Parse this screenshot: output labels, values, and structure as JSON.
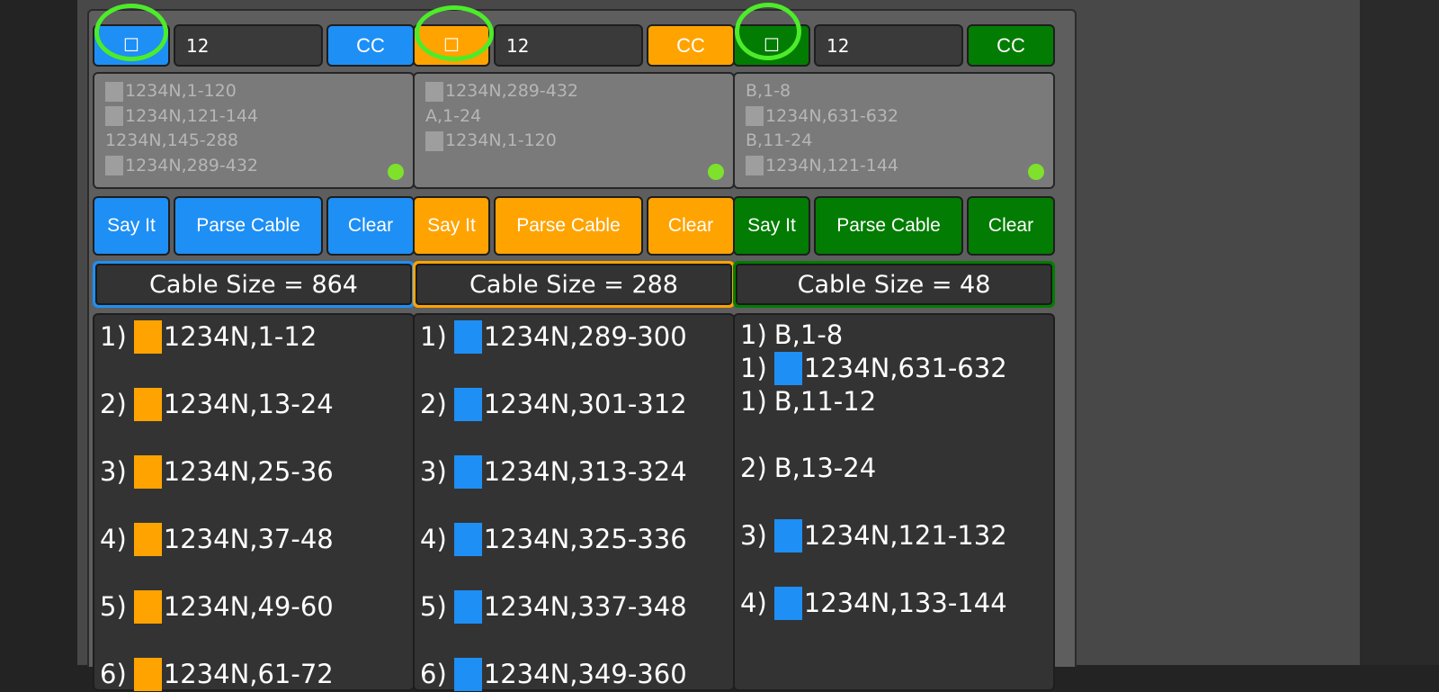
{
  "columns": [
    {
      "accent": "#1e8ff5",
      "checkbox": "☐",
      "count": "12",
      "cc_label": "CC",
      "input_lines": [
        {
          "sq": true,
          "text": "1234N,1-120"
        },
        {
          "sq": true,
          "text": "1234N,121-144"
        },
        {
          "sq": false,
          "text": "1234N,145-288"
        },
        {
          "sq": true,
          "text": "1234N,289-432"
        }
      ],
      "say_label": "Say It",
      "parse_label": "Parse Cable",
      "clear_label": "Clear",
      "cable_size": "Cable Size = 864",
      "results": [
        {
          "n": "1)",
          "sq": "#ffa300",
          "text": "1234N,1-12"
        },
        {
          "n": "2)",
          "sq": "#ffa300",
          "text": "1234N,13-24"
        },
        {
          "n": "3)",
          "sq": "#ffa300",
          "text": "1234N,25-36"
        },
        {
          "n": "4)",
          "sq": "#ffa300",
          "text": "1234N,37-48"
        },
        {
          "n": "5)",
          "sq": "#ffa300",
          "text": "1234N,49-60"
        },
        {
          "n": "6)",
          "sq": "#ffa300",
          "text": "1234N,61-72"
        }
      ]
    },
    {
      "accent": "#ffa300",
      "checkbox": "☐",
      "count": "12",
      "cc_label": "CC",
      "input_lines": [
        {
          "sq": true,
          "text": "1234N,289-432"
        },
        {
          "sq": false,
          "text": "A,1-24"
        },
        {
          "sq": true,
          "text": "1234N,1-120"
        }
      ],
      "say_label": "Say It",
      "parse_label": "Parse Cable",
      "clear_label": "Clear",
      "cable_size": "Cable Size = 288",
      "results": [
        {
          "n": "1)",
          "sq": "#1e8ff5",
          "text": "1234N,289-300"
        },
        {
          "n": "2)",
          "sq": "#1e8ff5",
          "text": "1234N,301-312"
        },
        {
          "n": "3)",
          "sq": "#1e8ff5",
          "text": "1234N,313-324"
        },
        {
          "n": "4)",
          "sq": "#1e8ff5",
          "text": "1234N,325-336"
        },
        {
          "n": "5)",
          "sq": "#1e8ff5",
          "text": "1234N,337-348"
        },
        {
          "n": "6)",
          "sq": "#1e8ff5",
          "text": "1234N,349-360"
        }
      ]
    },
    {
      "accent": "#037c03",
      "checkbox": "☐",
      "count": "12",
      "cc_label": "CC",
      "input_lines": [
        {
          "sq": false,
          "text": "B,1-8"
        },
        {
          "sq": true,
          "text": "1234N,631-632"
        },
        {
          "sq": false,
          "text": "B,11-24"
        },
        {
          "sq": true,
          "text": "1234N,121-144"
        }
      ],
      "say_label": "Say It",
      "parse_label": "Parse Cable",
      "clear_label": "Clear",
      "cable_size": "Cable Size = 48",
      "results": [
        {
          "n": "1)",
          "sq": "",
          "text": "B,1-8"
        },
        {
          "n": "1)",
          "sq": "#1e8ff5",
          "text": "1234N,631-632"
        },
        {
          "n": "1)",
          "sq": "",
          "text": "B,11-12"
        },
        {
          "n": "2)",
          "sq": "",
          "text": "B,13-24"
        },
        {
          "n": "3)",
          "sq": "#1e8ff5",
          "text": "1234N,121-132"
        },
        {
          "n": "4)",
          "sq": "#1e8ff5",
          "text": "1234N,133-144"
        }
      ]
    }
  ]
}
